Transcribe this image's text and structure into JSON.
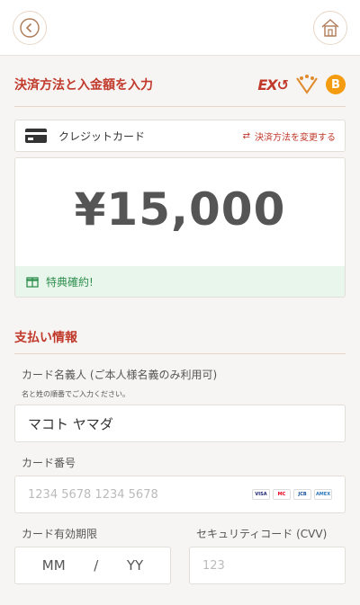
{
  "header": {
    "back_icon": "chevron-left-icon",
    "home_icon": "home-icon"
  },
  "payment_section": {
    "title": "決済方法と入金額を入力",
    "icons": [
      "ex-logo-icon",
      "bitcash-icon",
      "bitcoin-icon"
    ],
    "ex_text": "EX",
    "btc_text": "B"
  },
  "method": {
    "label": "クレジットカード",
    "change_label": "決済方法を変更する"
  },
  "amount": {
    "value": "¥15,000",
    "benefit_label": "特典確約!"
  },
  "payment_info": {
    "title": "支払い情報",
    "cardholder": {
      "label": "カード名義人 (ご本人様名義のみ利用可)",
      "note": "名と姓の順番でご入力ください。",
      "value": "マコト ヤマダ"
    },
    "card_number": {
      "label": "カード番号",
      "placeholder": "1234 5678 1234 5678",
      "brands": [
        "VISA",
        "MC",
        "JCB",
        "AMEX"
      ]
    },
    "expiry": {
      "label": "カード有効期限",
      "mm": "MM",
      "sep": "/",
      "yy": "YY"
    },
    "cvv": {
      "label": "セキュリティコード (CVV)",
      "placeholder": "123"
    }
  }
}
